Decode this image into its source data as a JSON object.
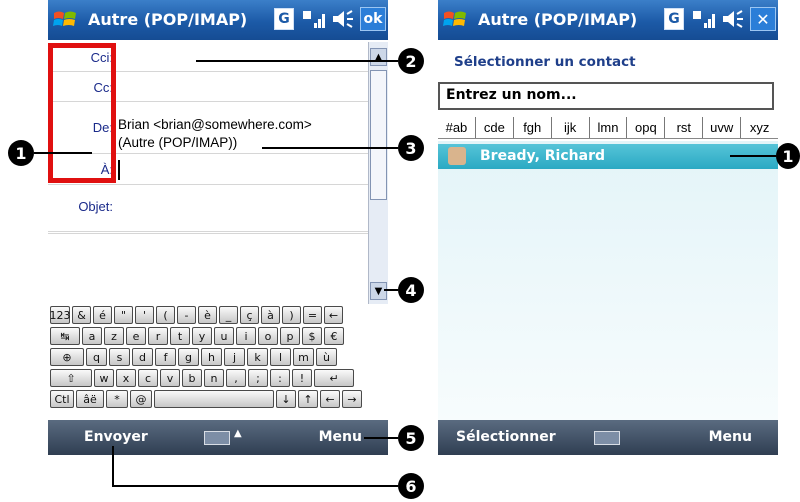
{
  "left_screen": {
    "title": "Autre (POP/IMAP)",
    "status": {
      "g_label": "G",
      "ok_label": "ok"
    },
    "fields": [
      {
        "label": "Cci:",
        "value": ""
      },
      {
        "label": "Cc:",
        "value": ""
      },
      {
        "label": "De:",
        "value_line1": "Brian <brian@somewhere.com>",
        "value_line2": "(Autre (POP/IMAP))"
      },
      {
        "label": "À:",
        "value": ""
      },
      {
        "label": "Objet:",
        "value": ""
      }
    ],
    "keyboard": {
      "row1": [
        "123",
        "&",
        "é",
        "\"",
        "'",
        "(",
        "-",
        "è",
        "_",
        "ç",
        "à",
        ")",
        "=",
        "←"
      ],
      "row2": [
        "↹",
        "a",
        "z",
        "e",
        "r",
        "t",
        "y",
        "u",
        "i",
        "o",
        "p",
        "$",
        "€"
      ],
      "row3": [
        "⊕",
        "q",
        "s",
        "d",
        "f",
        "g",
        "h",
        "j",
        "k",
        "l",
        "m",
        "ù"
      ],
      "row4": [
        "⇧",
        "w",
        "x",
        "c",
        "v",
        "b",
        "n",
        ",",
        ";",
        ":",
        "!",
        "↵"
      ],
      "row5": [
        "Ctl",
        "âë",
        "*",
        "@",
        " ",
        "↓",
        "↑",
        "←",
        "→"
      ]
    },
    "menubar": {
      "left_soft": "Envoyer",
      "right_soft": "Menu"
    }
  },
  "right_screen": {
    "title": "Autre (POP/IMAP)",
    "status": {
      "g_label": "G",
      "close_label": "✕"
    },
    "select_label": "Sélectionner un contact",
    "name_input": "Entrez un nom...",
    "filters": [
      "#ab",
      "cde",
      "fgh",
      "ijk",
      "lmn",
      "opq",
      "rst",
      "uvw",
      "xyz"
    ],
    "contacts": [
      {
        "name": "Bready, Richard"
      }
    ],
    "menubar": {
      "left_soft": "Sélectionner",
      "right_soft": "Menu"
    }
  },
  "callouts": {
    "c1": "1",
    "c2": "2",
    "c3": "3",
    "c4": "4",
    "c5": "5",
    "c6": "6",
    "c1_right": "1"
  }
}
